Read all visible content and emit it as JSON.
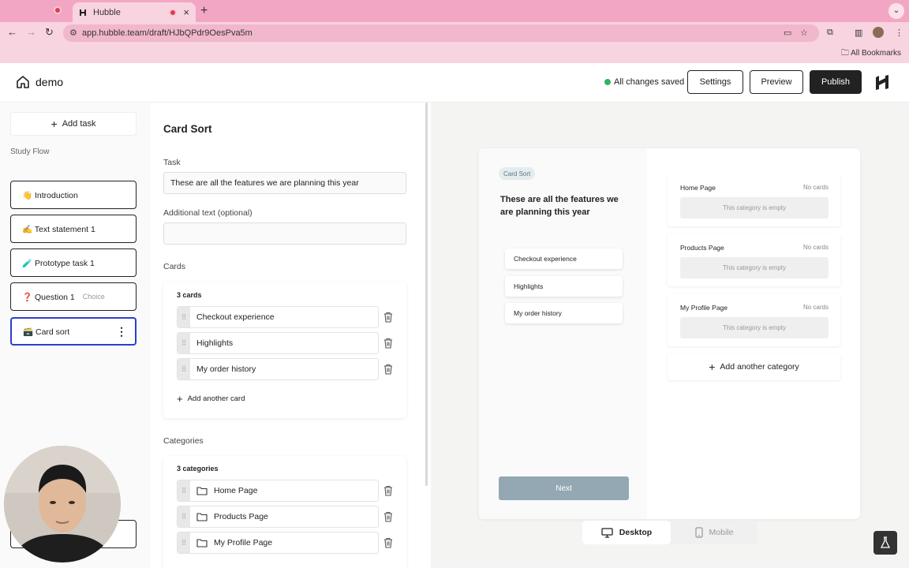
{
  "browser": {
    "tab_title": "Hubble",
    "url": "app.hubble.team/draft/HJbQPdr9OesPva5m",
    "bookmarks_label": "All Bookmarks"
  },
  "header": {
    "project_name": "demo",
    "save_status": "All changes saved",
    "settings_label": "Settings",
    "preview_label": "Preview",
    "publish_label": "Publish"
  },
  "sidebar": {
    "add_task_label": "Add task",
    "flow_label": "Study Flow",
    "items": [
      {
        "label": "👋 Introduction",
        "sub": ""
      },
      {
        "label": "✍️ Text statement 1",
        "sub": ""
      },
      {
        "label": "🧪 Prototype task 1",
        "sub": ""
      },
      {
        "label": "❓ Question 1",
        "sub": "Choice"
      },
      {
        "label": "🗃️ Card sort",
        "sub": ""
      }
    ]
  },
  "editor": {
    "title": "Card Sort",
    "task_label": "Task",
    "task_value": "These are all the features we are planning this year",
    "additional_label": "Additional text (optional)",
    "additional_value": "",
    "cards_label": "Cards",
    "cards_count": "3 cards",
    "cards": [
      "Checkout experience",
      "Highlights",
      "My order history"
    ],
    "add_card_label": "Add another card",
    "categories_label": "Categories",
    "categories_count": "3 categories",
    "categories": [
      "Home Page",
      "Products Page",
      "My Profile Page"
    ]
  },
  "preview": {
    "badge": "Card Sort",
    "task_text": "These are all the features we are planning this year",
    "cards": [
      "Checkout experience",
      "Highlights",
      "My order history"
    ],
    "next_label": "Next",
    "categories": [
      {
        "name": "Home Page",
        "status": "No cards",
        "empty_text": "This category is empty"
      },
      {
        "name": "Products Page",
        "status": "No cards",
        "empty_text": "This category is empty"
      },
      {
        "name": "My Profile Page",
        "status": "No cards",
        "empty_text": "This category is empty"
      }
    ],
    "add_category_label": "Add another category",
    "desktop_label": "Desktop",
    "mobile_label": "Mobile"
  },
  "colors": {
    "browser_chrome": "#f8d3e0",
    "accent_active": "#2c3fc9",
    "saved_green": "#2fb36a",
    "next_button": "#93a8b3"
  }
}
